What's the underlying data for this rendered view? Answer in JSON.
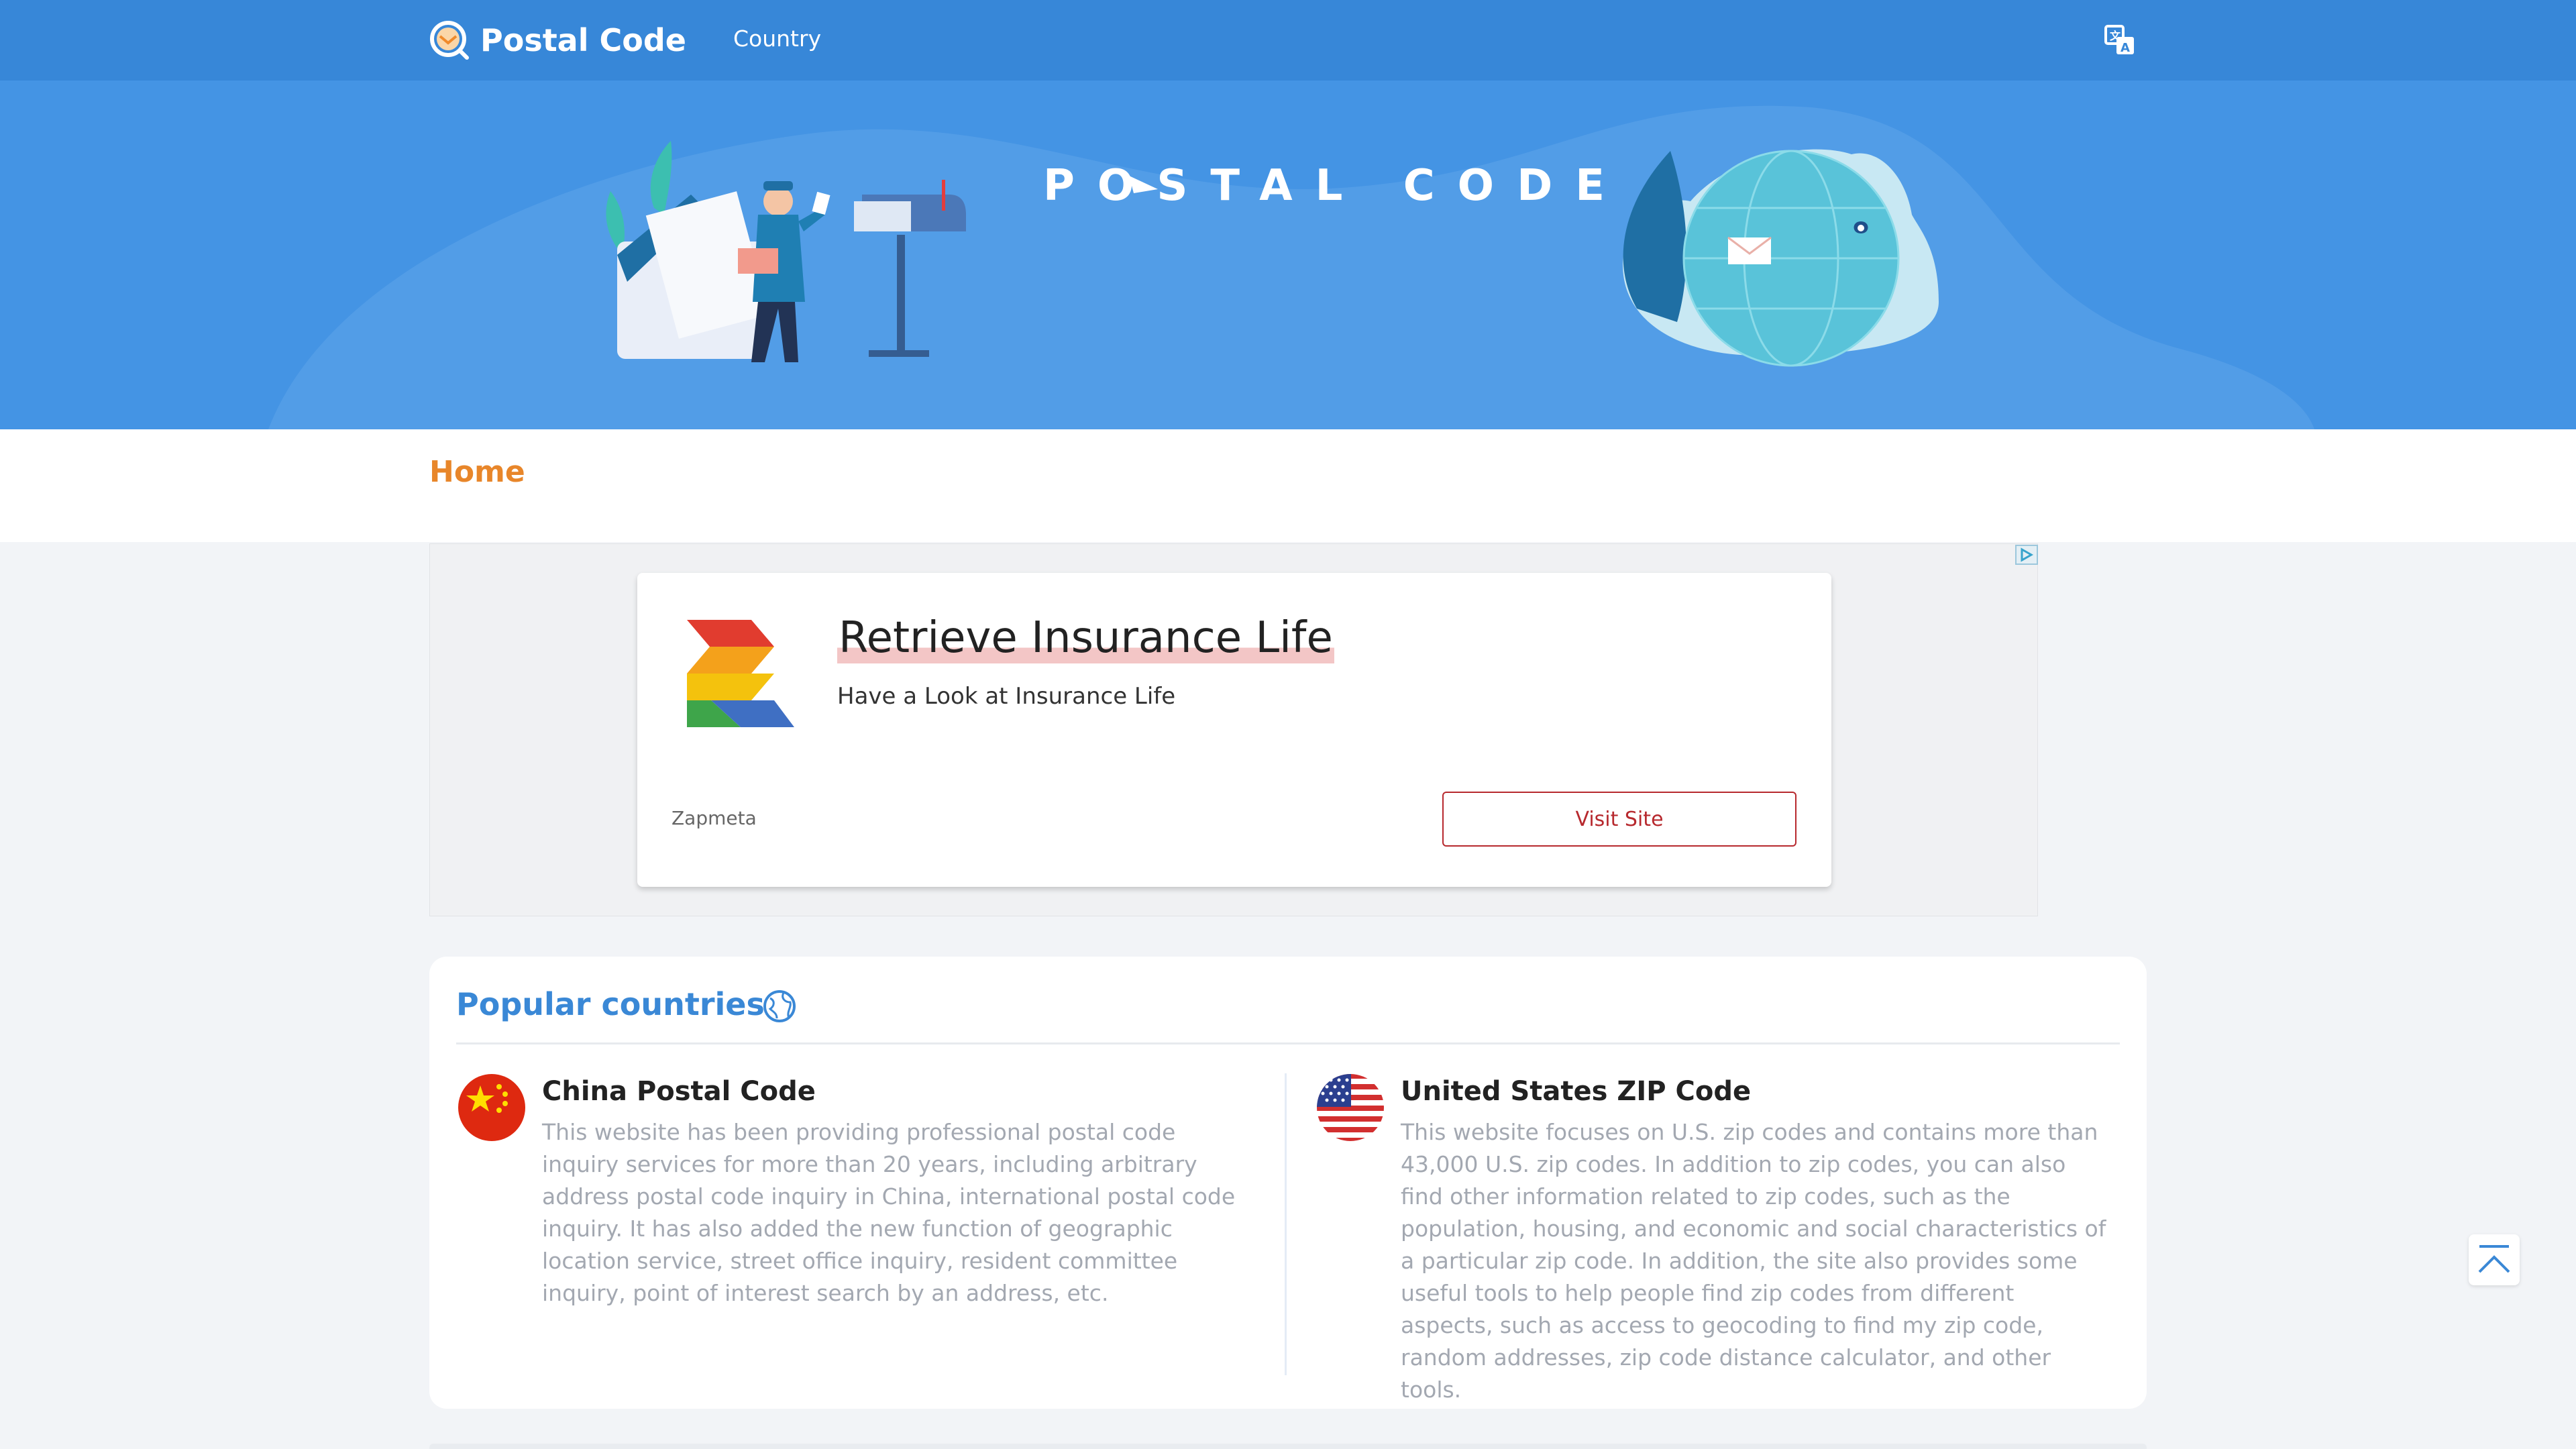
{
  "header": {
    "logo_text": "Postal Code",
    "nav": [
      {
        "label": "Country"
      }
    ],
    "translate_icon": "translate-icon",
    "bg_color": "#3787d8"
  },
  "hero": {
    "title": "POSTAL CODE",
    "bg_color": "#4494e4"
  },
  "breadcrumb": {
    "home": "Home",
    "color": "#e8862a"
  },
  "ad": {
    "title": "Retrieve Insurance Life",
    "subtitle": "Have a Look at Insurance Life",
    "brand": "Zapmeta",
    "cta": "Visit Site",
    "accent": "#b7292e"
  },
  "popular": {
    "title": "Popular countries",
    "title_icon": "globe-icon",
    "countries": [
      {
        "flag": "china-flag-icon",
        "name": "China Postal Code",
        "description": "This website has been providing professional postal code inquiry services for more than 20 years, including arbitrary address postal code inquiry in China, international postal code inquiry. It has also added the new function of geographic location service, street office inquiry, resident committee inquiry, point of interest search by an address, etc."
      },
      {
        "flag": "us-flag-icon",
        "name": "United States ZIP Code",
        "description": "This website focuses on U.S. zip codes and contains more than 43,000 U.S. zip codes. In addition to zip codes, you can also find other information related to zip codes, such as the population, housing, and economic and social characteristics of a particular zip code. In addition, the site also provides some useful tools to help people find zip codes from different aspects, such as access to geocoding to find my zip code, random addresses, zip code distance calculator, and other tools."
      }
    ]
  },
  "back_to_top_icon": "chevron-up-icon"
}
